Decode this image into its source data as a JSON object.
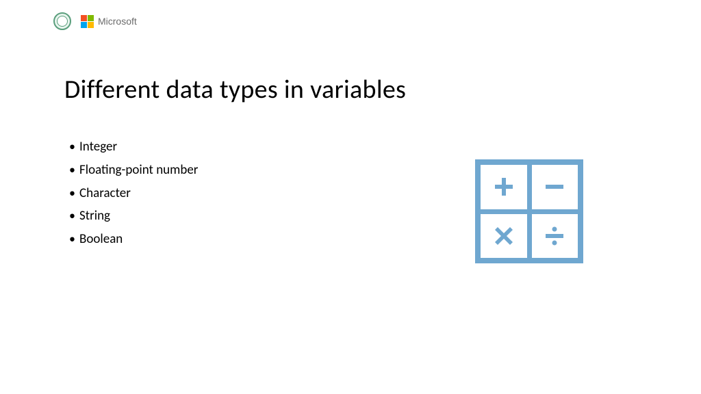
{
  "header": {
    "brand_text": "Microsoft"
  },
  "slide": {
    "title": "Different data types in variables",
    "bullets": [
      "Integer",
      "Floating-point number",
      "Character",
      "String",
      "Boolean"
    ]
  },
  "graphic": {
    "color": "#6fa7d0"
  }
}
